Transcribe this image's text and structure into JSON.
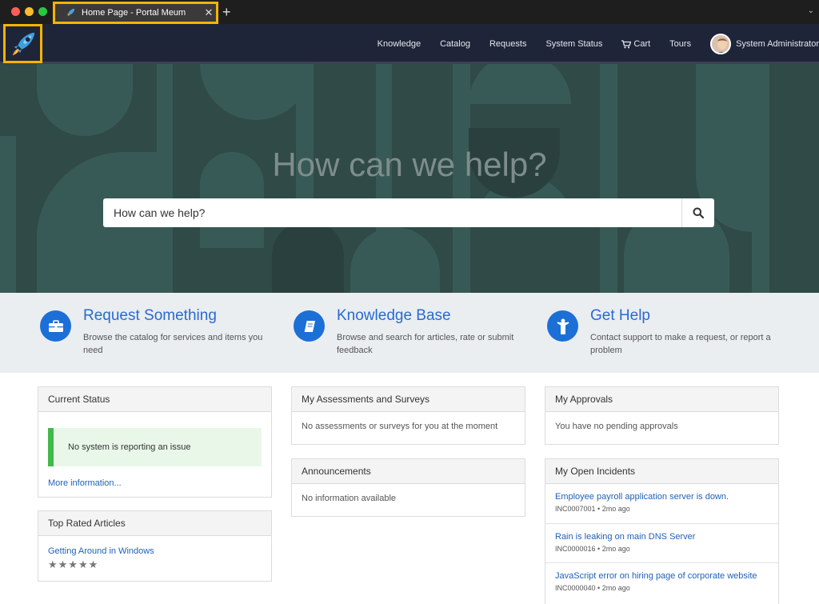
{
  "browser": {
    "tab_title": "Home Page - Portal Meum",
    "close_glyph": "✕",
    "new_tab_glyph": "+",
    "menu_glyph": "⌄"
  },
  "header": {
    "nav": [
      "Knowledge",
      "Catalog",
      "Requests",
      "System Status",
      "Cart",
      "Tours"
    ],
    "user_name": "System Administrator"
  },
  "hero": {
    "title": "How can we help?",
    "search_placeholder": "How can we help?"
  },
  "features": [
    {
      "title": "Request Something",
      "desc": "Browse the catalog for services and items you need",
      "icon": "briefcase-icon"
    },
    {
      "title": "Knowledge Base",
      "desc": "Browse and search for articles, rate or submit feedback",
      "icon": "book-icon"
    },
    {
      "title": "Get Help",
      "desc": "Contact support to make a request, or report a problem",
      "icon": "person-icon"
    }
  ],
  "panels": {
    "current_status": {
      "title": "Current Status",
      "message": "No system is reporting an issue",
      "link": "More information..."
    },
    "top_rated": {
      "title": "Top Rated Articles",
      "article": "Getting Around in Windows",
      "stars": "★★★★★",
      "rating": 5
    },
    "assessments": {
      "title": "My Assessments and Surveys",
      "message": "No assessments or surveys for you at the moment"
    },
    "announcements": {
      "title": "Announcements",
      "message": "No information available"
    },
    "approvals": {
      "title": "My Approvals",
      "message": "You have no pending approvals"
    },
    "incidents": {
      "title": "My Open Incidents",
      "items": [
        {
          "title": "Employee payroll application server is down.",
          "meta": "INC0007001 • 2mo ago"
        },
        {
          "title": "Rain is leaking on main DNS Server",
          "meta": "INC0000016 • 2mo ago"
        },
        {
          "title": "JavaScript error on hiring page of corporate website",
          "meta": "INC0000040 • 2mo ago"
        }
      ]
    }
  },
  "colors": {
    "accent": "#1c6fd6",
    "header_bg": "#1f2538",
    "hero_bg": "#2f4a47",
    "highlight": "#f4b400",
    "ok": "#43b84b"
  }
}
